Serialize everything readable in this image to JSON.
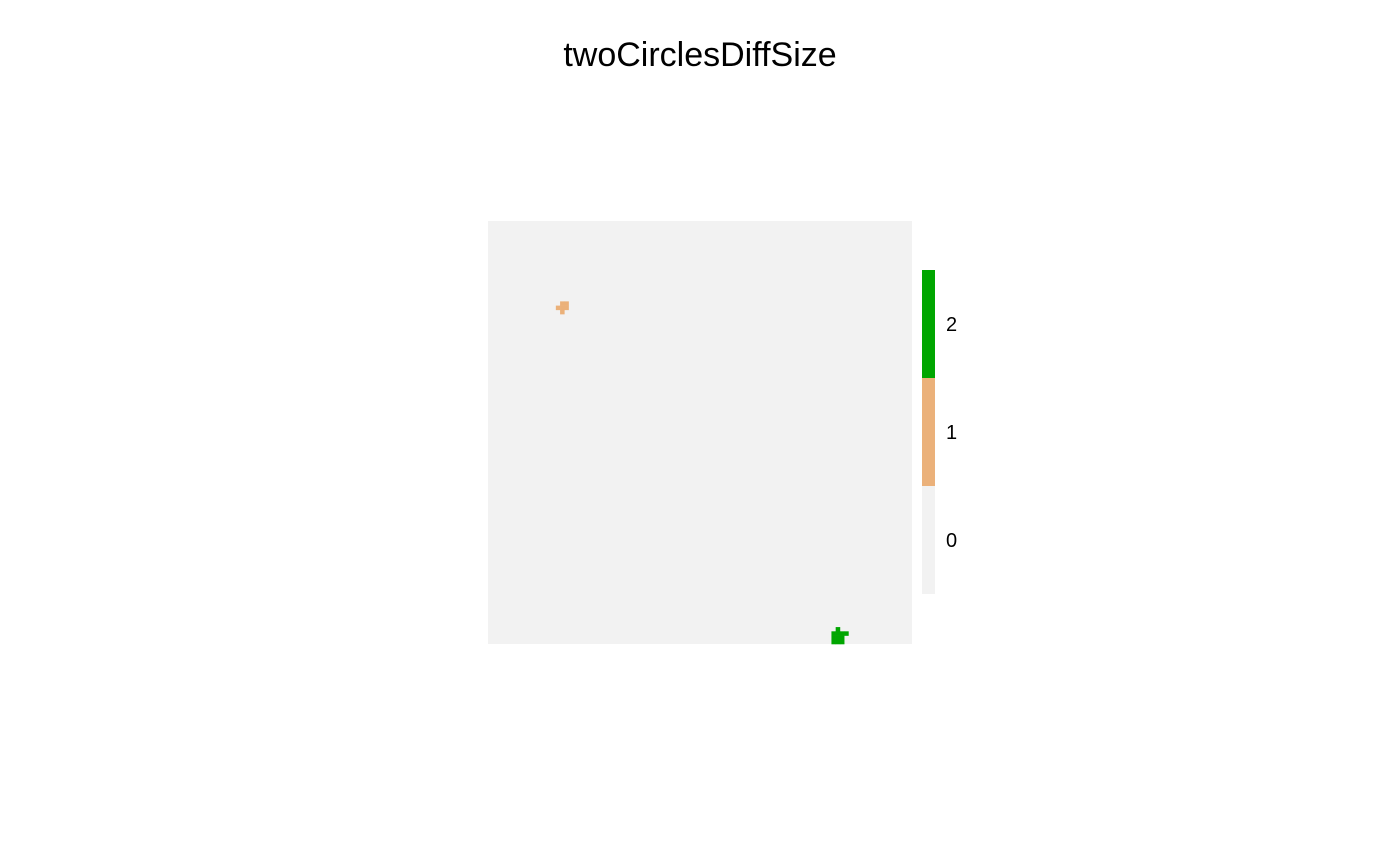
{
  "chart_data": {
    "type": "heatmap",
    "title": "twoCirclesDiffSize",
    "xlabel": "",
    "ylabel": "",
    "grid_size": 100,
    "background_value": 0,
    "categories": [
      {
        "value": 0,
        "label": "0",
        "color": "#F2F2F2"
      },
      {
        "value": 1,
        "label": "1",
        "color": "#EBB17A"
      },
      {
        "value": 2,
        "label": "2",
        "color": "#00A600"
      }
    ],
    "cells": [
      {
        "row": 19,
        "col": 17,
        "value": 1
      },
      {
        "row": 19,
        "col": 18,
        "value": 1
      },
      {
        "row": 20,
        "col": 17,
        "value": 1
      },
      {
        "row": 20,
        "col": 18,
        "value": 1
      },
      {
        "row": 20,
        "col": 16,
        "value": 1
      },
      {
        "row": 21,
        "col": 17,
        "value": 1
      },
      {
        "row": 96,
        "col": 82,
        "value": 2
      },
      {
        "row": 97,
        "col": 81,
        "value": 2
      },
      {
        "row": 97,
        "col": 82,
        "value": 2
      },
      {
        "row": 97,
        "col": 83,
        "value": 2
      },
      {
        "row": 97,
        "col": 84,
        "value": 2
      },
      {
        "row": 98,
        "col": 81,
        "value": 2
      },
      {
        "row": 98,
        "col": 82,
        "value": 2
      },
      {
        "row": 98,
        "col": 83,
        "value": 2
      },
      {
        "row": 99,
        "col": 81,
        "value": 2
      },
      {
        "row": 99,
        "col": 82,
        "value": 2
      },
      {
        "row": 99,
        "col": 83,
        "value": 2
      }
    ],
    "legend": {
      "placement": "right",
      "labels": [
        "2",
        "1",
        "0"
      ]
    },
    "grid": false
  }
}
